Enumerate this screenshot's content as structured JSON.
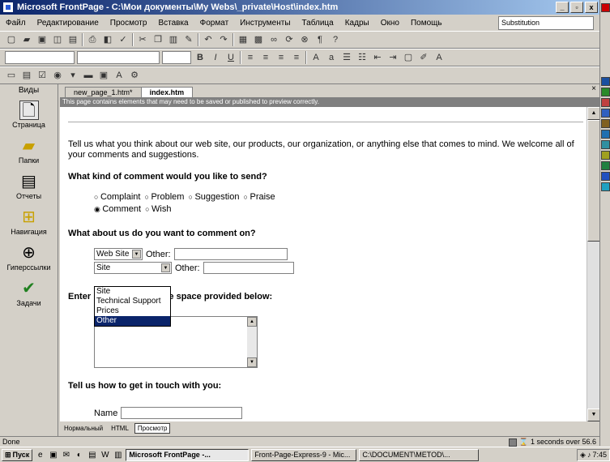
{
  "window": {
    "title": "Microsoft FrontPage - C:\\Мои документы\\My Webs\\_private\\Host\\index.htm",
    "min": "_",
    "restore": "▫",
    "close": "x"
  },
  "menu": [
    "Файл",
    "Редактирование",
    "Просмотр",
    "Вставка",
    "Формат",
    "Инструменты",
    "Таблица",
    "Кадры",
    "Окно",
    "Помощь"
  ],
  "font_combo": "Substitution",
  "views": {
    "header": "Виды",
    "items": [
      {
        "label": "Страница",
        "icon": "page-icon"
      },
      {
        "label": "Папки",
        "icon": "folders-icon"
      },
      {
        "label": "Отчеты",
        "icon": "reports-icon"
      },
      {
        "label": "Навигация",
        "icon": "navigation-icon"
      },
      {
        "label": "Гиперссылки",
        "icon": "hyperlinks-icon"
      },
      {
        "label": "Задачи",
        "icon": "tasks-icon"
      }
    ]
  },
  "tabs": [
    {
      "label": "new_page_1.htm*"
    },
    {
      "label": "index.htm"
    }
  ],
  "infobar": "This page contains elements that may need to be saved or published to preview correctly.",
  "page": {
    "intro": "Tell us what you think about our web site, our products, our organization, or anything else that comes to mind. We welcome all of your comments and suggestions.",
    "q1": "What kind of comment would you like to send?",
    "options1": [
      "Complaint",
      "Problem",
      "Suggestion",
      "Praise"
    ],
    "options2": [
      "Comment",
      "Wish"
    ],
    "checked": "Comment",
    "q2": "What about us do you want to comment on?",
    "sel1": "Web Site",
    "sel2": "Site",
    "other_label": "Other:",
    "dropdown_options": [
      "Site",
      "Technical Support",
      "Prices",
      "Other"
    ],
    "dropdown_selected": "Other",
    "q3_start": "Enter",
    "q3_end": "in the space provided below:",
    "q4": "Tell us how to get in touch with you:",
    "name_label": "Name"
  },
  "viewtabs": [
    {
      "label": "Нормальный"
    },
    {
      "label": "HTML"
    },
    {
      "label": "Просмотр"
    }
  ],
  "status": {
    "left": "Done",
    "right": "1 seconds over 56.6"
  },
  "taskbar": {
    "start": "Пуск",
    "tasks": [
      "Microsoft FrontPage -...",
      "Front-Page-Express-9 - Mic...",
      "C:\\DOCUMENT\\METOD\\..."
    ],
    "clock": "7:45"
  }
}
